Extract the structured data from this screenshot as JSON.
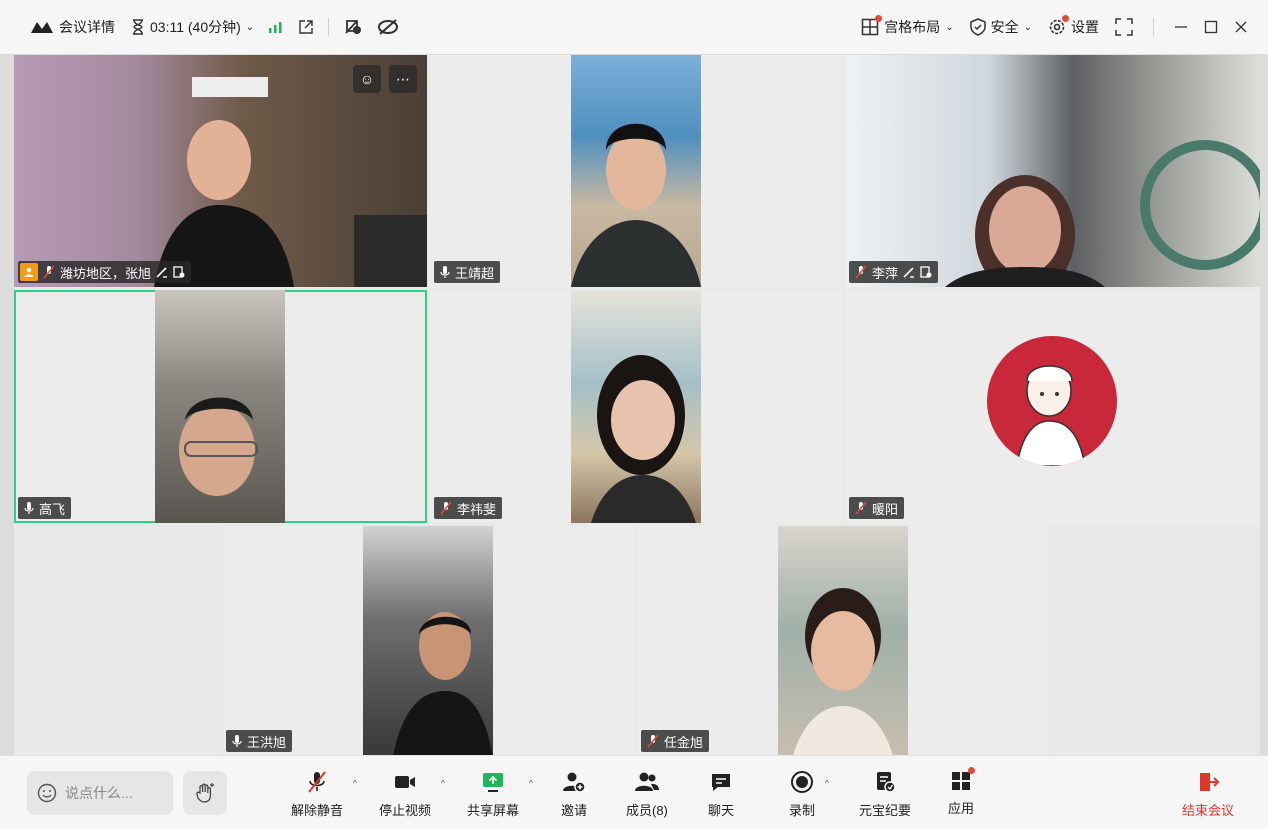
{
  "topbar": {
    "meeting_details": "会议详情",
    "timer": "03:11 (40分钟)",
    "layout": "宫格布局",
    "security": "安全",
    "settings": "设置"
  },
  "tiles": [
    {
      "name": "潍坊地区，张旭",
      "mic": "muted",
      "host": true
    },
    {
      "name": "王靖超",
      "mic": "on"
    },
    {
      "name": "李萍",
      "mic": "muted"
    },
    {
      "name": "高飞",
      "mic": "on",
      "active": true
    },
    {
      "name": "李祎斐",
      "mic": "muted"
    },
    {
      "name": "暖阳",
      "mic": "muted"
    },
    {
      "name": "王洪旭",
      "mic": "on"
    },
    {
      "name": "任金旭",
      "mic": "muted"
    }
  ],
  "bottombar": {
    "chat_placeholder": "说点什么...",
    "unmute": "解除静音",
    "stop_video": "停止视频",
    "share_screen": "共享屏幕",
    "invite": "邀请",
    "members": "成员(8)",
    "chat": "聊天",
    "record": "录制",
    "yuanbao": "元宝纪要",
    "apps": "应用",
    "end_meeting": "结束会议"
  },
  "colors": {
    "end": "#e3362a",
    "active_border": "#2fcf85",
    "host_badge": "#f39c12",
    "signal": "#1fb55a"
  }
}
